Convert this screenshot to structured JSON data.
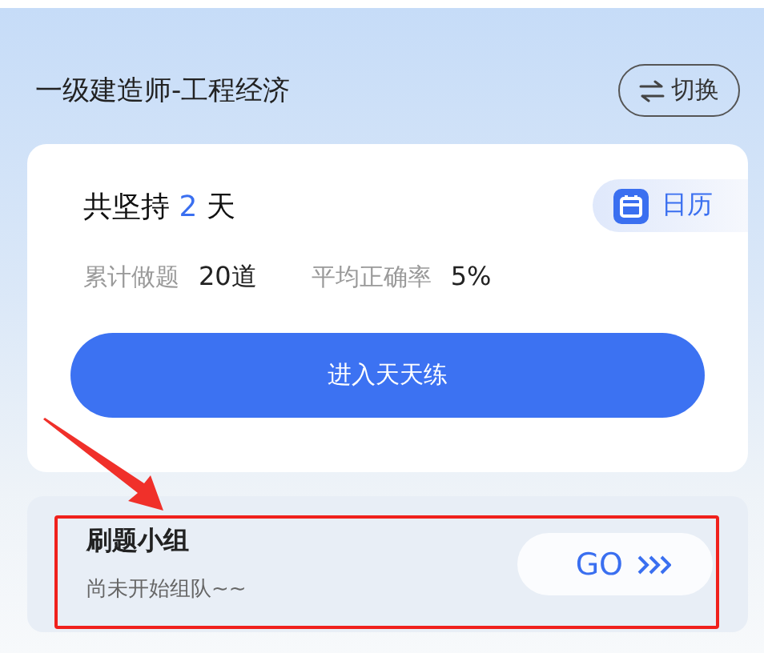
{
  "header": {
    "title": "一级建造师-工程经济",
    "switch_button": "切换"
  },
  "progress_card": {
    "streak_prefix": "共坚持",
    "streak_count": "2",
    "streak_suffix": "天",
    "calendar_button": "日历",
    "stats": [
      {
        "label": "累计做题",
        "value": "20道"
      },
      {
        "label": "平均正确率",
        "value": "5%"
      }
    ],
    "primary_button": "进入天天练"
  },
  "group_card": {
    "title": "刷题小组",
    "subtitle": "尚未开始组队~~",
    "go_button": "GO"
  },
  "markup": {
    "arrow": true,
    "frame": true
  }
}
